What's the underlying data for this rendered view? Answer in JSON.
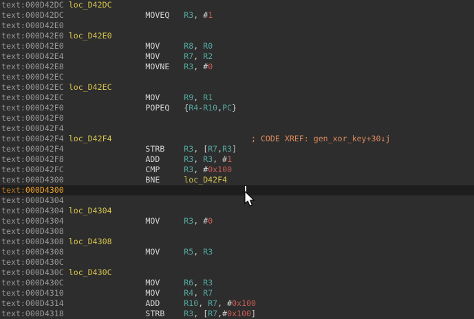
{
  "view": {
    "function_name_in_comment": "gen_xor_key",
    "xref_comment": "; CODE XREF: gen_xor_key+30↓j",
    "highlighted_address": "text:000D4300"
  },
  "colors": {
    "background": "#2d2d2d",
    "highlight_row_background": "#1e1e1e",
    "address": "#999999",
    "label": "#d6c44e",
    "mnemonic": "#d6d6d6",
    "register": "#54a8a0",
    "immediate": "#cd5b54",
    "comment": "#dd8a5c",
    "highlight_address": "#f0a226"
  },
  "rows": [
    {
      "segs": [
        [
          "a",
          "text:000D42DC"
        ],
        [
          "p",
          " "
        ],
        [
          "l",
          "loc_D42DC"
        ]
      ]
    },
    {
      "segs": [
        [
          "a",
          "text:000D42DC"
        ],
        [
          "p",
          "                 "
        ],
        [
          "m",
          "MOVEQ"
        ],
        [
          "p",
          "   "
        ],
        [
          "r",
          "R3"
        ],
        [
          "p",
          ", #"
        ],
        [
          "n",
          "1"
        ]
      ]
    },
    {
      "segs": [
        [
          "a",
          "text:000D42E0"
        ]
      ]
    },
    {
      "segs": [
        [
          "a",
          "text:000D42E0"
        ],
        [
          "p",
          " "
        ],
        [
          "l",
          "loc_D42E0"
        ]
      ]
    },
    {
      "segs": [
        [
          "a",
          "text:000D42E0"
        ],
        [
          "p",
          "                 "
        ],
        [
          "m",
          "MOV"
        ],
        [
          "p",
          "     "
        ],
        [
          "r",
          "R8"
        ],
        [
          "p",
          ", "
        ],
        [
          "r",
          "R0"
        ]
      ]
    },
    {
      "segs": [
        [
          "a",
          "text:000D42E4"
        ],
        [
          "p",
          "                 "
        ],
        [
          "m",
          "MOV"
        ],
        [
          "p",
          "     "
        ],
        [
          "r",
          "R7"
        ],
        [
          "p",
          ", "
        ],
        [
          "r",
          "R2"
        ]
      ]
    },
    {
      "segs": [
        [
          "a",
          "text:000D42E8"
        ],
        [
          "p",
          "                 "
        ],
        [
          "m",
          "MOVNE"
        ],
        [
          "p",
          "   "
        ],
        [
          "r",
          "R3"
        ],
        [
          "p",
          ", #"
        ],
        [
          "n",
          "0"
        ]
      ]
    },
    {
      "segs": [
        [
          "a",
          "text:000D42EC"
        ]
      ]
    },
    {
      "segs": [
        [
          "a",
          "text:000D42EC"
        ],
        [
          "p",
          " "
        ],
        [
          "l",
          "loc_D42EC"
        ]
      ]
    },
    {
      "segs": [
        [
          "a",
          "text:000D42EC"
        ],
        [
          "p",
          "                 "
        ],
        [
          "m",
          "MOV"
        ],
        [
          "p",
          "     "
        ],
        [
          "r",
          "R9"
        ],
        [
          "p",
          ", "
        ],
        [
          "r",
          "R1"
        ]
      ]
    },
    {
      "segs": [
        [
          "a",
          "text:000D42F0"
        ],
        [
          "p",
          "                 "
        ],
        [
          "m",
          "POPEQ"
        ],
        [
          "p",
          "   {"
        ],
        [
          "r",
          "R4"
        ],
        [
          "p",
          "-"
        ],
        [
          "r",
          "R10"
        ],
        [
          "p",
          ","
        ],
        [
          "r",
          "PC"
        ],
        [
          "p",
          "}"
        ]
      ]
    },
    {
      "segs": [
        [
          "a",
          "text:000D42F0"
        ]
      ]
    },
    {
      "segs": [
        [
          "a",
          "text:000D42F4"
        ]
      ]
    },
    {
      "segs": [
        [
          "a",
          "text:000D42F4"
        ],
        [
          "p",
          " "
        ],
        [
          "l",
          "loc_D42F4"
        ],
        [
          "p",
          "                             "
        ],
        [
          "c",
          "; CODE XREF: gen_xor_key+30↓j"
        ]
      ]
    },
    {
      "segs": [
        [
          "a",
          "text:000D42F4"
        ],
        [
          "p",
          "                 "
        ],
        [
          "m",
          "STRB"
        ],
        [
          "p",
          "    "
        ],
        [
          "r",
          "R3"
        ],
        [
          "p",
          ", ["
        ],
        [
          "r",
          "R7"
        ],
        [
          "p",
          ","
        ],
        [
          "r",
          "R3"
        ],
        [
          "p",
          "]"
        ]
      ]
    },
    {
      "segs": [
        [
          "a",
          "text:000D42F8"
        ],
        [
          "p",
          "                 "
        ],
        [
          "m",
          "ADD"
        ],
        [
          "p",
          "     "
        ],
        [
          "r",
          "R3"
        ],
        [
          "p",
          ", "
        ],
        [
          "r",
          "R3"
        ],
        [
          "p",
          ", #"
        ],
        [
          "n",
          "1"
        ]
      ]
    },
    {
      "segs": [
        [
          "a",
          "text:000D42FC"
        ],
        [
          "p",
          "                 "
        ],
        [
          "m",
          "CMP"
        ],
        [
          "p",
          "     "
        ],
        [
          "r",
          "R3"
        ],
        [
          "p",
          ", #"
        ],
        [
          "n",
          "0x100"
        ]
      ]
    },
    {
      "segs": [
        [
          "a",
          "text:000D4300"
        ],
        [
          "p",
          "                 "
        ],
        [
          "m",
          "BNE"
        ],
        [
          "p",
          "     "
        ],
        [
          "l",
          "loc_D42F4"
        ]
      ]
    },
    {
      "hl": true,
      "segs": [
        [
          "hd",
          "text:"
        ],
        [
          "hb",
          "000D4300"
        ]
      ]
    },
    {
      "segs": [
        [
          "a",
          "text:000D4304"
        ]
      ]
    },
    {
      "segs": [
        [
          "a",
          "text:000D4304"
        ],
        [
          "p",
          " "
        ],
        [
          "l",
          "loc_D4304"
        ]
      ]
    },
    {
      "segs": [
        [
          "a",
          "text:000D4304"
        ],
        [
          "p",
          "                 "
        ],
        [
          "m",
          "MOV"
        ],
        [
          "p",
          "     "
        ],
        [
          "r",
          "R3"
        ],
        [
          "p",
          ", #"
        ],
        [
          "n",
          "0"
        ]
      ]
    },
    {
      "segs": [
        [
          "a",
          "text:000D4308"
        ]
      ]
    },
    {
      "segs": [
        [
          "a",
          "text:000D4308"
        ],
        [
          "p",
          " "
        ],
        [
          "l",
          "loc_D4308"
        ]
      ]
    },
    {
      "segs": [
        [
          "a",
          "text:000D4308"
        ],
        [
          "p",
          "                 "
        ],
        [
          "m",
          "MOV"
        ],
        [
          "p",
          "     "
        ],
        [
          "r",
          "R5"
        ],
        [
          "p",
          ", "
        ],
        [
          "r",
          "R3"
        ]
      ]
    },
    {
      "segs": [
        [
          "a",
          "text:000D430C"
        ]
      ]
    },
    {
      "segs": [
        [
          "a",
          "text:000D430C"
        ],
        [
          "p",
          " "
        ],
        [
          "l",
          "loc_D430C"
        ]
      ]
    },
    {
      "segs": [
        [
          "a",
          "text:000D430C"
        ],
        [
          "p",
          "                 "
        ],
        [
          "m",
          "MOV"
        ],
        [
          "p",
          "     "
        ],
        [
          "r",
          "R6"
        ],
        [
          "p",
          ", "
        ],
        [
          "r",
          "R3"
        ]
      ]
    },
    {
      "segs": [
        [
          "a",
          "text:000D4310"
        ],
        [
          "p",
          "                 "
        ],
        [
          "m",
          "MOV"
        ],
        [
          "p",
          "     "
        ],
        [
          "r",
          "R4"
        ],
        [
          "p",
          ", "
        ],
        [
          "r",
          "R7"
        ]
      ]
    },
    {
      "segs": [
        [
          "a",
          "text:000D4314"
        ],
        [
          "p",
          "                 "
        ],
        [
          "m",
          "ADD"
        ],
        [
          "p",
          "     "
        ],
        [
          "r",
          "R10"
        ],
        [
          "p",
          ", "
        ],
        [
          "r",
          "R7"
        ],
        [
          "p",
          ", #"
        ],
        [
          "n",
          "0x100"
        ]
      ]
    },
    {
      "segs": [
        [
          "a",
          "text:000D4318"
        ],
        [
          "p",
          "                 "
        ],
        [
          "m",
          "STRB"
        ],
        [
          "p",
          "    "
        ],
        [
          "r",
          "R3"
        ],
        [
          "p",
          ", ["
        ],
        [
          "r",
          "R7"
        ],
        [
          "p",
          ",#"
        ],
        [
          "n",
          "0x100"
        ],
        [
          "p",
          "]"
        ]
      ]
    }
  ]
}
